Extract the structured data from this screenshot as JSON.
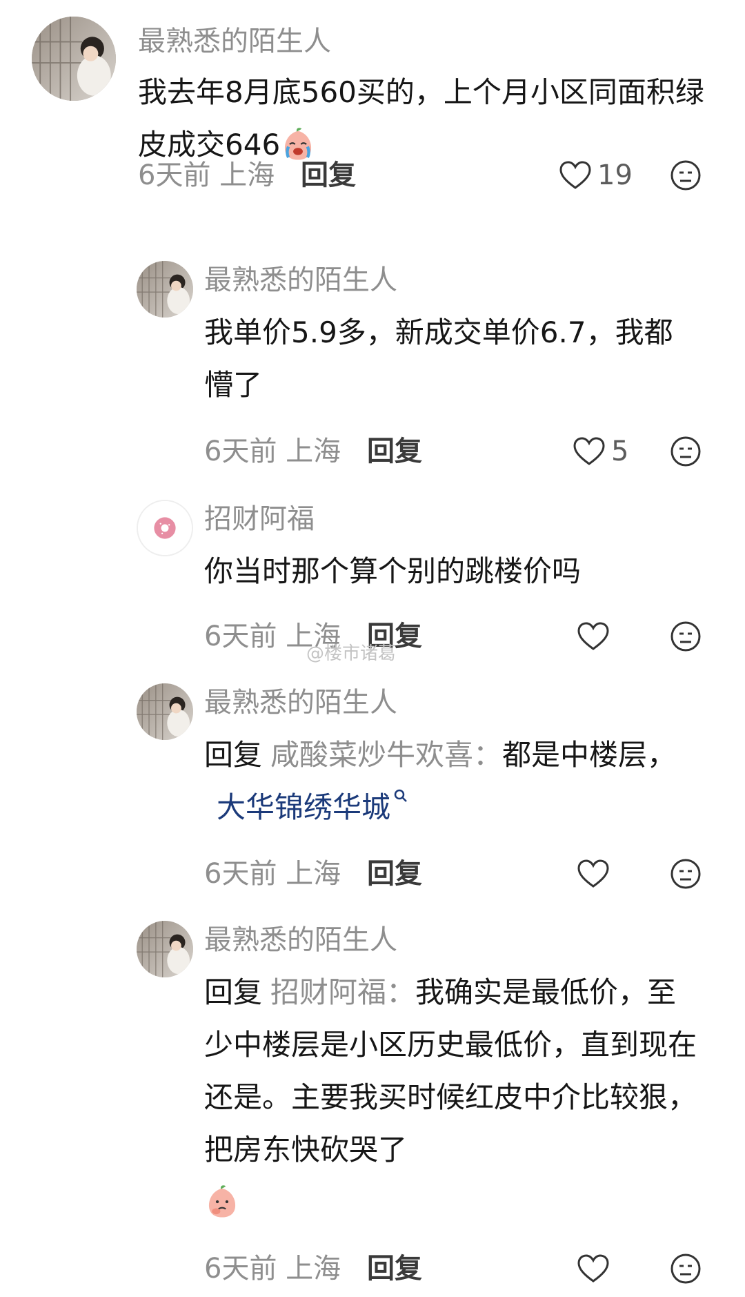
{
  "comments": [
    {
      "username": "最熟悉的陌生人",
      "text_parts": [
        "我去年8月底560买的，上个月小区同面积绿皮成交646"
      ],
      "emoji": "crying-peach-emoji",
      "time": "6天前 上海",
      "reply": "回复",
      "likes": "19"
    },
    {
      "username": "最熟悉的陌生人",
      "text": "我单价5.9多，新成交单价6.7，我都懵了",
      "time": "6天前 上海",
      "reply": "回复",
      "likes": "5"
    },
    {
      "username": "招财阿福",
      "text": "你当时那个算个别的跳楼价吗",
      "time": "6天前 上海",
      "reply": "回复",
      "likes": ""
    },
    {
      "username": "最熟悉的陌生人",
      "reply_prefix": "回复",
      "reply_target": "咸酸菜炒牛欢喜：",
      "text": "都是中楼层，",
      "link": "大华锦绣华城",
      "time": "6天前 上海",
      "reply": "回复",
      "likes": ""
    },
    {
      "username": "最熟悉的陌生人",
      "reply_prefix": "回复",
      "reply_target": "招财阿福：",
      "text": "我确实是最低价，至少中楼层是小区历史最低价，直到现在还是。主要我买时候红皮中介比较狠，把房东快砍哭了",
      "emoji": "thinking-peach-emoji",
      "time": "6天前 上海",
      "reply": "回复",
      "likes": ""
    }
  ],
  "watermark": "@楼市诸葛",
  "colors": {
    "username": "#8e8e8e",
    "text": "#161616",
    "link": "#1b3a7a",
    "meta": "#8e8e8e"
  }
}
